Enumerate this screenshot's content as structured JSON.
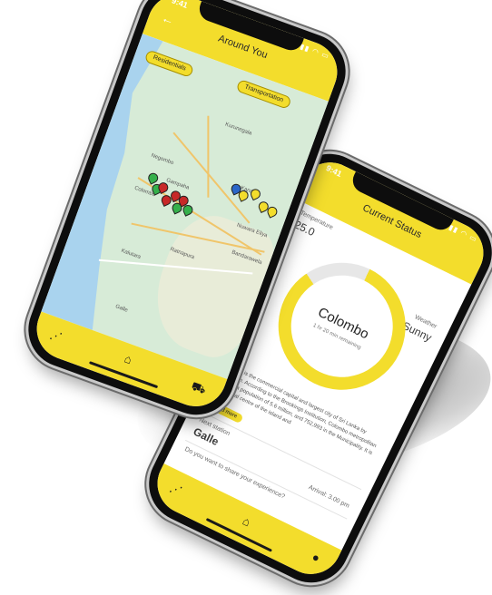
{
  "colors": {
    "accent": "#f3dd2c",
    "map_land": "#d7ebd7",
    "sea": "#a9d3ee"
  },
  "front": {
    "status_time": "9:41",
    "title": "Around You",
    "chips": [
      "Residentials",
      "Transportation"
    ],
    "towns": [
      "Negombo",
      "Colombo",
      "Gampaha",
      "Kurunegala",
      "Kandy",
      "Ratnapura",
      "Kalutara",
      "Galle",
      "Bandarawela",
      "Nuwara Eliya"
    ],
    "nav": {
      "left": "share-icon",
      "center": "home-icon",
      "right": "tuk-tuk-icon"
    }
  },
  "back": {
    "status_time": "9:41",
    "title": "Current Status",
    "temperature_label": "Temperature",
    "temperature_value": "25.0",
    "weather_label": "Weather",
    "weather_value": "Sunny",
    "city": "Colombo",
    "remaining": "1 hr 20 min remaining",
    "description": "Colombo is the commercial capital and largest city of Sri Lanka by population. According to the Brookings Institution, Colombo metropolitan area has a population of 5.6 million, and 752,993 in the Municipality. It is the financial centre of the island and",
    "read_more": "Read more",
    "next_station_label": "Next station",
    "next_station_value": "Galle",
    "arrival": "Arrival: 3.00 pm",
    "share_prompt": "Do you want to share your experience?"
  }
}
